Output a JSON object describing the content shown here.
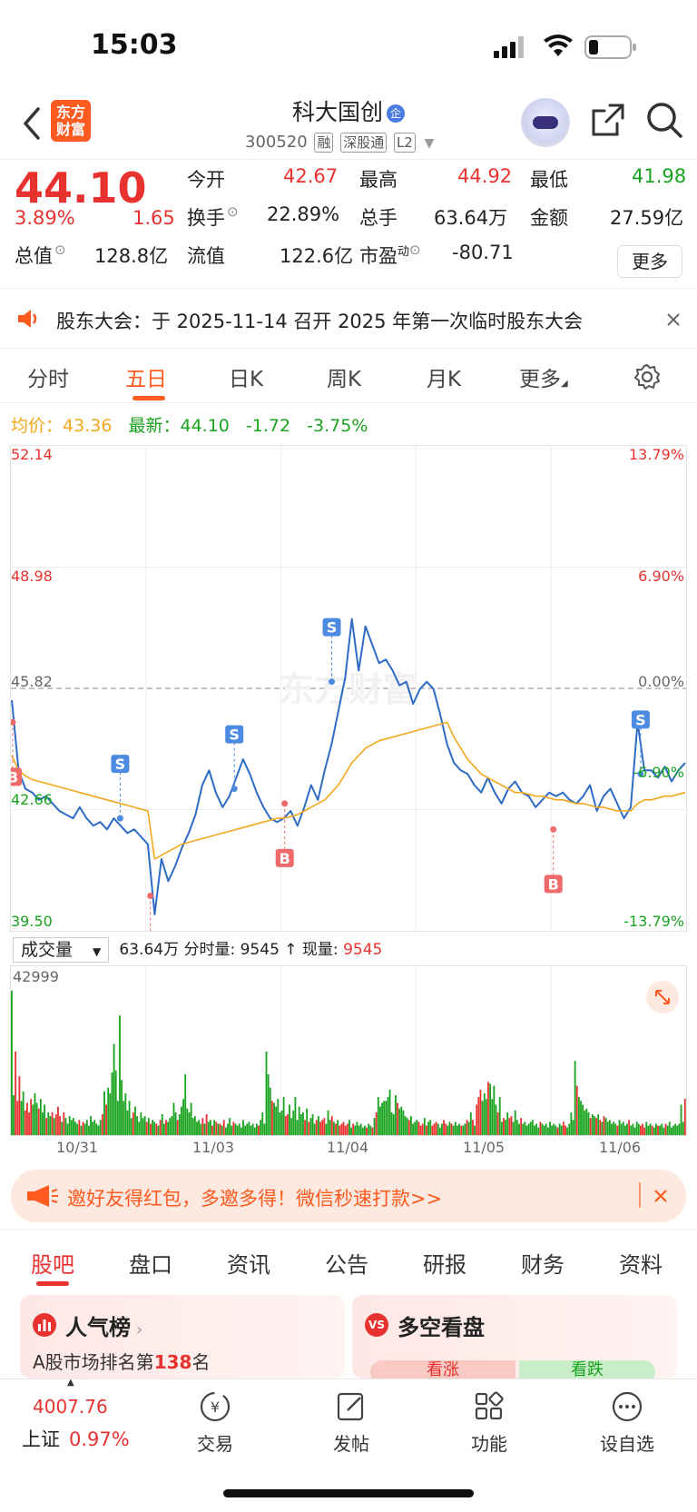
{
  "status_bar": {
    "time": "15:03"
  },
  "header": {
    "logo_text": "东方财富",
    "stock_name": "科大国创",
    "name_badge": "企",
    "code": "300520",
    "tags": [
      "融",
      "深股通",
      "L2"
    ]
  },
  "quote": {
    "price": "44.10",
    "change_pct": "3.89%",
    "change": "1.65",
    "open_label": "今开",
    "open": "42.67",
    "high_label": "最高",
    "high": "44.92",
    "low_label": "最低",
    "low": "41.98",
    "turnover_label": "换手",
    "turnover": "22.89%",
    "volume_label": "总手",
    "volume": "63.64万",
    "amount_label": "金额",
    "amount": "27.59亿",
    "mktcap_label": "总值",
    "mktcap": "128.8亿",
    "float_label": "流值",
    "float": "122.6亿",
    "pe_label": "市盈",
    "pe_sup": "动",
    "pe": "-80.71",
    "more_label": "更多"
  },
  "notice": {
    "text": "股东大会：于 2025-11-14 召开 2025 年第一次临时股东大会"
  },
  "chart_tabs": [
    "分时",
    "五日",
    "日K",
    "周K",
    "月K",
    "更多"
  ],
  "active_chart_tab": "五日",
  "avg_line": {
    "avg_label": "均价：",
    "avg_value": "43.36",
    "latest_label": "最新：",
    "latest_value": "44.10",
    "change": "-1.72",
    "change_pct": "-3.75%"
  },
  "chart_data": {
    "type": "line",
    "x": [
      "10/31",
      "11/03",
      "11/04",
      "11/05",
      "11/06"
    ],
    "y_left_ticks": [
      "52.14",
      "48.98",
      "45.82",
      "42.66",
      "39.50"
    ],
    "y_right_ticks": [
      "13.79%",
      "6.90%",
      "0.00%",
      "-6.90%",
      "-13.79%"
    ],
    "ylim": [
      39.5,
      52.14
    ],
    "prev_close": 45.82,
    "watermark": "东方财富",
    "series": [
      {
        "kind": "price",
        "color": "#2e6bc6",
        "values": [
          45.5,
          43.6,
          43.1,
          43.0,
          42.8,
          42.9,
          42.7,
          42.5,
          42.4,
          42.3,
          42.6,
          42.3,
          42.1,
          42.2,
          42.0,
          42.3,
          42.1,
          41.9,
          42.0,
          41.8,
          41.6,
          39.7,
          41.2,
          40.6,
          41.0,
          41.5,
          41.9,
          42.4,
          43.2,
          43.6,
          43.0,
          42.6,
          42.9,
          43.4,
          43.9,
          43.5,
          43.0,
          42.6,
          42.3,
          42.2,
          42.3,
          42.5,
          42.1,
          42.6,
          43.2,
          42.8,
          43.6,
          44.3,
          45.2,
          46.1,
          47.7,
          46.3,
          47.5,
          47.0,
          46.5,
          46.6,
          46.3,
          45.9,
          46.0,
          45.4,
          45.8,
          46.0,
          45.8,
          45.1,
          44.3,
          43.8,
          43.6,
          43.5,
          43.2,
          43.0,
          43.4,
          43.0,
          42.7,
          43.1,
          43.3,
          43.0,
          42.9,
          42.6,
          42.8,
          43.0,
          42.9,
          43.0,
          42.8,
          42.7,
          42.9,
          43.2,
          42.5,
          42.9,
          43.1,
          42.7,
          42.3,
          42.6,
          44.9,
          43.6,
          43.6,
          43.4,
          43.7,
          43.3,
          43.6,
          43.8
        ]
      },
      {
        "kind": "average",
        "color": "#f2a81d",
        "values": [
          44.0,
          43.6,
          43.45,
          43.35,
          43.3,
          43.25,
          43.2,
          43.15,
          43.1,
          43.05,
          43.0,
          42.95,
          42.9,
          42.85,
          42.8,
          42.75,
          42.7,
          42.65,
          42.6,
          42.55,
          42.5,
          41.2,
          41.3,
          41.4,
          41.5,
          41.6,
          41.65,
          41.7,
          41.75,
          41.8,
          41.85,
          41.9,
          41.95,
          42.0,
          42.05,
          42.1,
          42.15,
          42.2,
          42.25,
          42.3,
          42.3,
          42.35,
          42.4,
          42.5,
          42.6,
          42.7,
          42.8,
          43.0,
          43.2,
          43.5,
          43.8,
          44.0,
          44.2,
          44.3,
          44.4,
          44.45,
          44.5,
          44.55,
          44.6,
          44.65,
          44.7,
          44.75,
          44.8,
          44.85,
          44.9,
          44.5,
          44.2,
          43.9,
          43.7,
          43.5,
          43.4,
          43.3,
          43.2,
          43.1,
          43.0,
          43.0,
          42.95,
          42.9,
          42.9,
          42.85,
          42.8,
          42.8,
          42.75,
          42.7,
          42.7,
          42.65,
          42.6,
          42.6,
          42.55,
          42.5,
          42.5,
          42.5,
          42.7,
          42.8,
          42.8,
          42.85,
          42.9,
          42.9,
          42.95,
          43.0
        ]
      }
    ],
    "signals": [
      {
        "label": "B",
        "x": 0.0,
        "price": 44.9
      },
      {
        "label": "S",
        "x": 0.16,
        "price": 42.3
      },
      {
        "label": "B",
        "x": 0.205,
        "price": 40.2
      },
      {
        "label": "S",
        "x": 0.33,
        "price": 43.1
      },
      {
        "label": "B",
        "x": 0.405,
        "price": 42.7
      },
      {
        "label": "S",
        "x": 0.475,
        "price": 46.0
      },
      {
        "label": "B",
        "x": 0.805,
        "price": 42.0
      },
      {
        "label": "S",
        "x": 0.935,
        "price": 43.5
      }
    ]
  },
  "volume": {
    "selector_label": "成交量",
    "total": "63.64万",
    "info": "分时量: 9545 ↑ 现量:",
    "current": "9545",
    "max_tick": "42999",
    "bars": [
      38000,
      10500,
      22000,
      9000,
      15500,
      9000,
      11500,
      6500,
      8500,
      6000,
      9500,
      8000,
      11000,
      8500,
      7000,
      9500,
      6000,
      8000,
      4500,
      6000,
      5000,
      6000,
      4500,
      5500,
      7500,
      5000,
      3500,
      6000,
      4500,
      3000,
      5000,
      4000,
      4500,
      3500,
      3000,
      4000,
      2500,
      3500,
      3000,
      4000,
      2500,
      5000,
      3500,
      4000,
      3000,
      2500,
      4000,
      5500,
      11500,
      8000,
      12500,
      11000,
      16500,
      24000,
      17000,
      9000,
      31500,
      14500,
      9000,
      11000,
      6500,
      9000,
      4500,
      6000,
      7500,
      5000,
      3500,
      6000,
      4500,
      5000,
      3500,
      4500,
      3000,
      4000,
      3500,
      3000,
      2500,
      4000,
      5500,
      3000,
      4000,
      3500,
      4500,
      5000,
      8500,
      6000,
      4000,
      5500,
      7500,
      9500,
      16000,
      7000,
      6000,
      8500,
      4500,
      5000,
      3500,
      4000,
      3000,
      4500,
      3000,
      5500,
      3500,
      4000,
      2500,
      4000,
      3500,
      3000,
      3000,
      2500,
      4000,
      2000,
      3000,
      4500,
      2500,
      3500,
      3000,
      2500,
      3000,
      2000,
      4000,
      2500,
      3000,
      3500,
      2500,
      3000,
      2000,
      3000,
      2500,
      4000,
      6000,
      3000,
      22000,
      16000,
      12500,
      9000,
      8500,
      7500,
      9500,
      6000,
      6500,
      10000,
      5000,
      5500,
      8000,
      4500,
      6500,
      10000,
      4000,
      7500,
      5500,
      6000,
      4000,
      7000,
      3500,
      4500,
      5500,
      3000,
      4000,
      5000,
      3500,
      4000,
      4500,
      3000,
      6500,
      4000,
      5000,
      3500,
      3000,
      4000,
      2500,
      3000,
      3500,
      2500,
      3000,
      4000,
      2000,
      3000,
      2500,
      3500,
      2500,
      3000,
      2000,
      2500,
      2000,
      3000,
      2500,
      2000,
      4500,
      6000,
      10000,
      7500,
      8500,
      9000,
      9000,
      10000,
      12000,
      6000,
      5500,
      10500,
      8500,
      7000,
      7500,
      6500,
      5000,
      4500,
      4000,
      5000,
      3000,
      3500,
      4000,
      3500,
      2500,
      3000,
      4500,
      2500,
      3500,
      4000,
      2500,
      3000,
      3500,
      3000,
      2000,
      3000,
      4000,
      3000,
      2500,
      3500,
      3000,
      2500,
      3500,
      2500,
      3000,
      2500,
      2500,
      3000,
      4000,
      3500,
      6000,
      4000,
      2500,
      8000,
      10000,
      12000,
      9000,
      11000,
      9500,
      14000,
      13500,
      9500,
      13000,
      8000,
      6000,
      10000,
      3500,
      4500,
      4000,
      6000,
      4500,
      5000,
      3500,
      6500,
      4000,
      3000,
      4500,
      3000,
      3500,
      2500,
      3000,
      3500,
      4000,
      2500,
      3000,
      2000,
      3500,
      3000,
      2500,
      3000,
      2000,
      3500,
      2500,
      3000,
      2500,
      2000,
      3000,
      2500,
      3500,
      2500,
      2000,
      3000,
      6000,
      4000,
      19500,
      13000,
      10000,
      9000,
      8000,
      6500,
      7000,
      6000,
      4500,
      5500,
      5000,
      4500,
      5500,
      4000,
      3500,
      5000,
      4500,
      3500,
      4000,
      3000,
      3500,
      3000,
      2500,
      4000,
      3000,
      3500,
      2500,
      3000,
      4000,
      2500,
      3000,
      2000,
      3500,
      3000,
      2500,
      3000,
      2000,
      3500,
      2500,
      3000,
      2500,
      2000,
      3000,
      2500,
      2500,
      3000,
      2000,
      3000,
      2500,
      3500,
      2000,
      2500,
      3000,
      2500,
      3000,
      8000,
      3500,
      9545
    ]
  },
  "x_dates": [
    "10/31",
    "11/03",
    "11/04",
    "11/05",
    "11/06"
  ],
  "banner": {
    "text": "邀好友得红包，多邀多得！微信秒速打款>>"
  },
  "bottom_tabs": [
    "股吧",
    "盘口",
    "资讯",
    "公告",
    "研报",
    "财务",
    "资料"
  ],
  "active_bottom_tab": "股吧",
  "cards": {
    "left": {
      "title": "人气榜",
      "sub_prefix": "A股市场排名第",
      "rank": "138",
      "sub_suffix": "名"
    },
    "right": {
      "title": "多空看盘",
      "up": "看涨",
      "down": "看跌"
    }
  },
  "bottom_bar": {
    "index_value": "4007.76",
    "index_name": "上证",
    "index_change": "0.97%",
    "items": [
      "交易",
      "发帖",
      "功能",
      "设自选"
    ]
  },
  "colors": {
    "accent": "#ff5a1f",
    "up": "#e8322f",
    "down": "#19a31f",
    "price_line": "#2e6bc6",
    "avg_line": "#f2a81d"
  }
}
